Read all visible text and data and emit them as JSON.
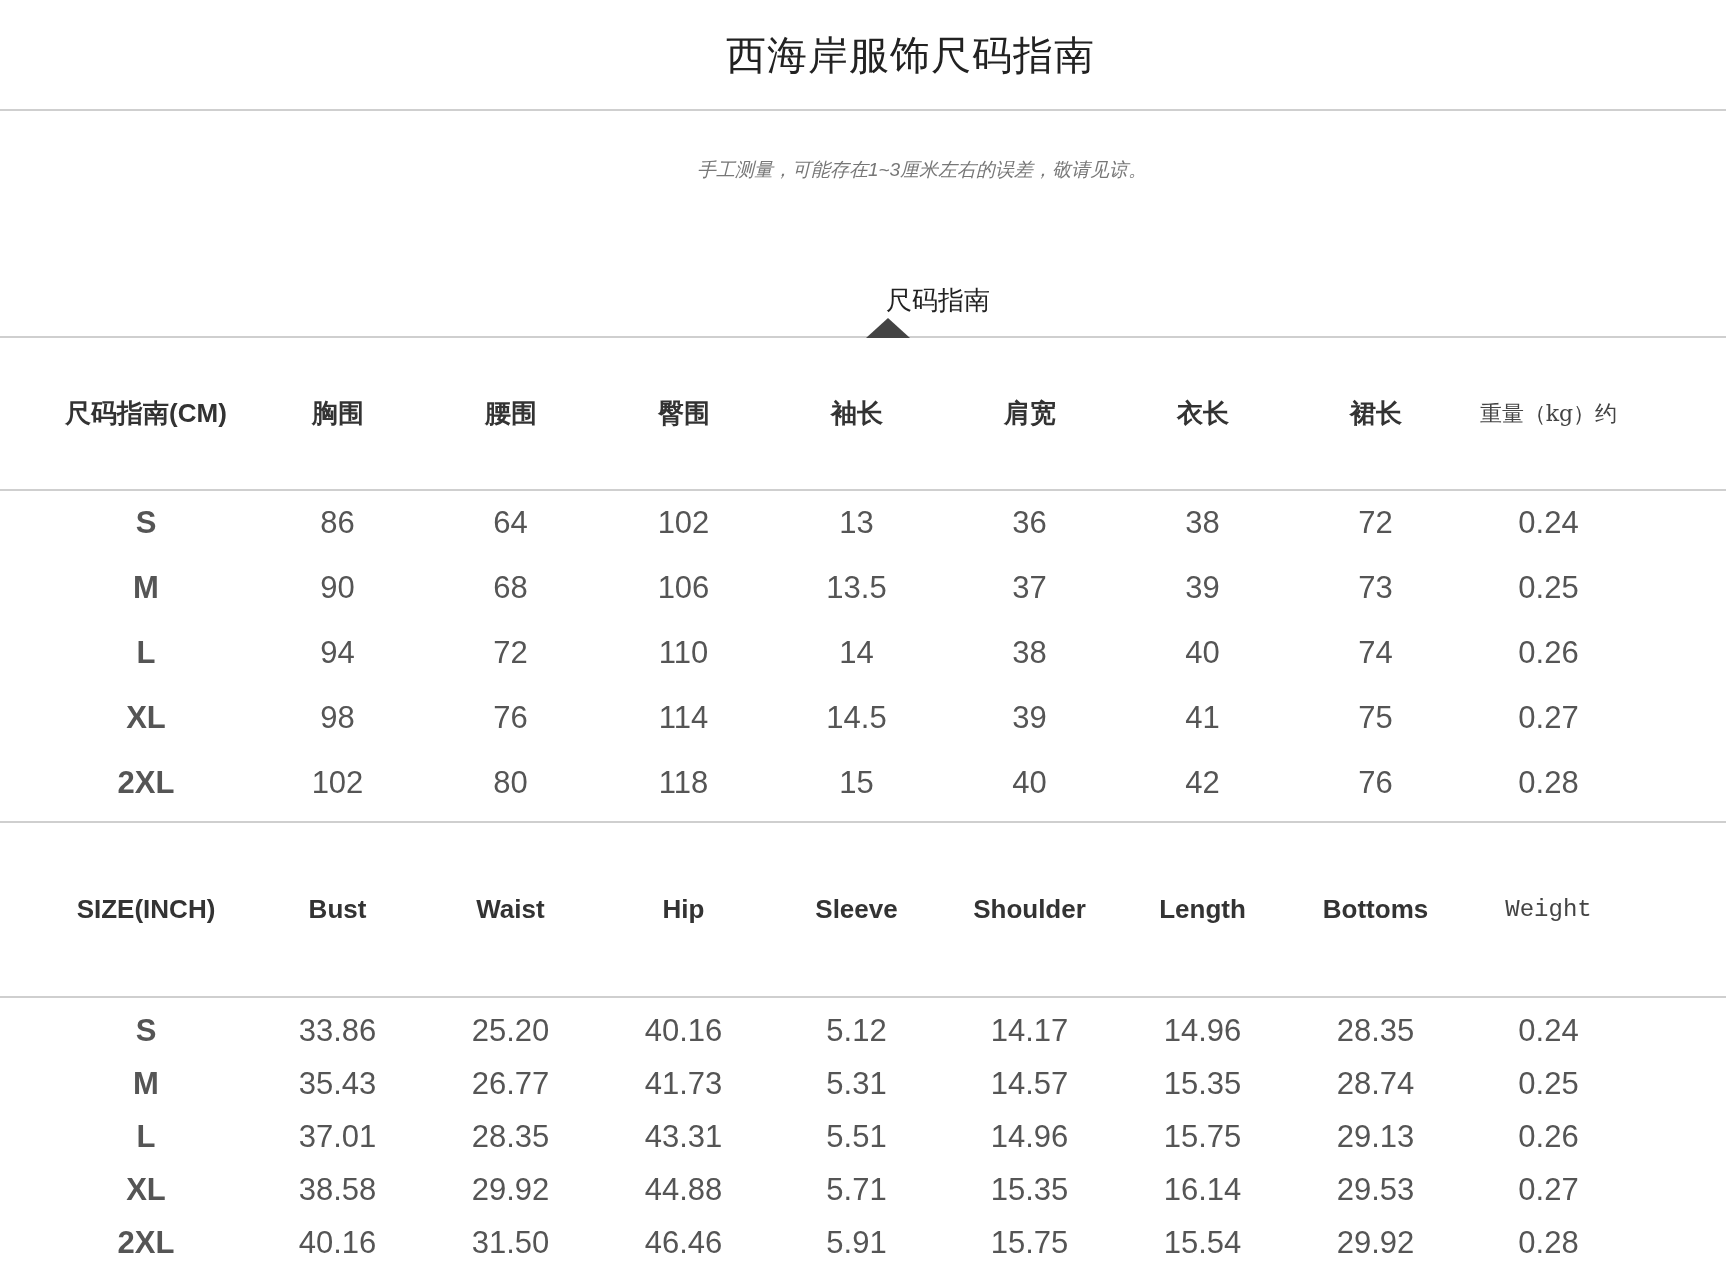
{
  "title": "西海岸服饰尺码指南",
  "note": "手工测量，可能存在1~3厘米左右的误差，敬请见谅。",
  "section_tab": {
    "label": "尺码指南"
  },
  "tables": [
    {
      "columns": [
        "尺码指南(CM)",
        "胸围",
        "腰围",
        "臀围",
        "袖长",
        "肩宽",
        "衣长",
        "裙长",
        "重量（kg）约"
      ],
      "rows": [
        [
          "S",
          "86",
          "64",
          "102",
          "13",
          "36",
          "38",
          "72",
          "0.24"
        ],
        [
          "M",
          "90",
          "68",
          "106",
          "13.5",
          "37",
          "39",
          "73",
          "0.25"
        ],
        [
          "L",
          "94",
          "72",
          "110",
          "14",
          "38",
          "40",
          "74",
          "0.26"
        ],
        [
          "XL",
          "98",
          "76",
          "114",
          "14.5",
          "39",
          "41",
          "75",
          "0.27"
        ],
        [
          "2XL",
          "102",
          "80",
          "118",
          "15",
          "40",
          "42",
          "76",
          "0.28"
        ]
      ]
    },
    {
      "columns": [
        "SIZE(INCH)",
        "Bust",
        "Waist",
        "Hip",
        "Sleeve",
        "Shoulder",
        "Length",
        "Bottoms",
        "Weight"
      ],
      "rows": [
        [
          "S",
          "33.86",
          "25.20",
          "40.16",
          "5.12",
          "14.17",
          "14.96",
          "28.35",
          "0.24"
        ],
        [
          "M",
          "35.43",
          "26.77",
          "41.73",
          "5.31",
          "14.57",
          "15.35",
          "28.74",
          "0.25"
        ],
        [
          "L",
          "37.01",
          "28.35",
          "43.31",
          "5.51",
          "14.96",
          "15.75",
          "29.13",
          "0.26"
        ],
        [
          "XL",
          "38.58",
          "29.92",
          "44.88",
          "5.71",
          "15.35",
          "16.14",
          "29.53",
          "0.27"
        ],
        [
          "2XL",
          "40.16",
          "31.50",
          "46.46",
          "5.91",
          "15.75",
          "15.54",
          "29.92",
          "0.28"
        ]
      ]
    }
  ]
}
